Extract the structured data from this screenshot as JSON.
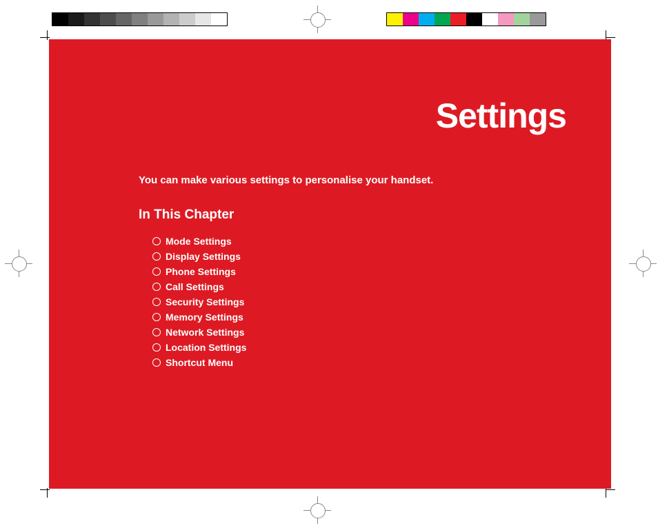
{
  "title": "Settings",
  "intro": "You can make various settings to personalise your handset.",
  "heading": "In This Chapter",
  "items": [
    "Mode Settings",
    "Display Settings",
    "Phone Settings",
    "Call Settings",
    "Security Settings",
    "Memory Settings",
    "Network Settings",
    "Location Settings",
    "Shortcut Menu"
  ],
  "gray_ramp": [
    "#000000",
    "#1a1a1a",
    "#333333",
    "#4d4d4d",
    "#666666",
    "#808080",
    "#999999",
    "#b3b3b3",
    "#cccccc",
    "#e6e6e6",
    "#ffffff"
  ],
  "color_bar": [
    "#fff200",
    "#ec008c",
    "#00aeef",
    "#00a651",
    "#ed1c24",
    "#000000",
    "#ffffff",
    "#f49ac1",
    "#a3d39c",
    "#999999"
  ]
}
